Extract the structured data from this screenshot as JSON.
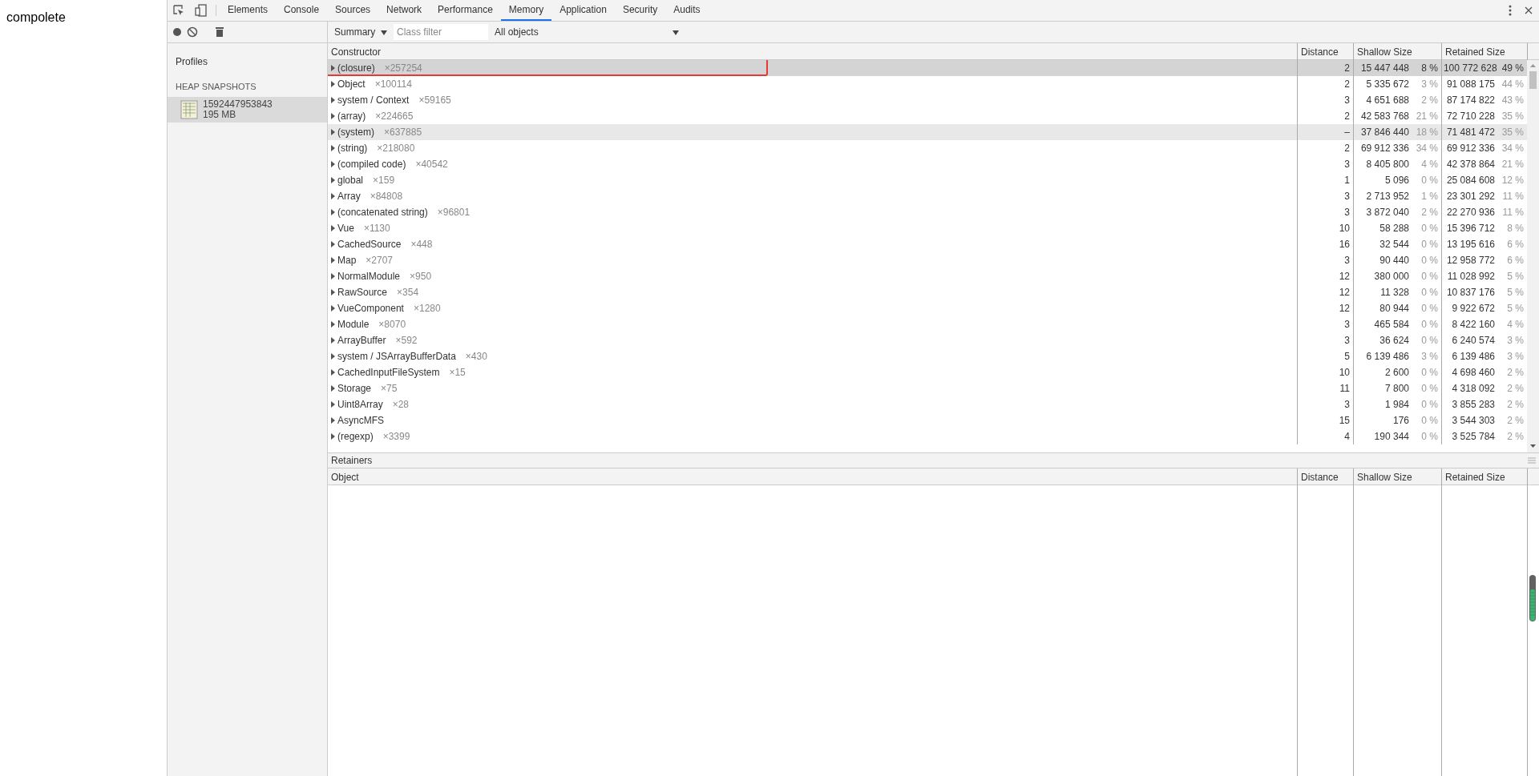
{
  "page_text": "compolete",
  "tabs": [
    {
      "label": "Elements",
      "selected": false
    },
    {
      "label": "Console",
      "selected": false
    },
    {
      "label": "Sources",
      "selected": false
    },
    {
      "label": "Network",
      "selected": false
    },
    {
      "label": "Performance",
      "selected": false
    },
    {
      "label": "Memory",
      "selected": true
    },
    {
      "label": "Application",
      "selected": false
    },
    {
      "label": "Security",
      "selected": false
    },
    {
      "label": "Audits",
      "selected": false
    }
  ],
  "toolbar": {
    "view": "Summary",
    "filter_placeholder": "Class filter",
    "scope": "All objects"
  },
  "sidebar": {
    "title": "Profiles",
    "section": "HEAP SNAPSHOTS",
    "items": [
      {
        "name": "1592447953843",
        "size": "195 MB",
        "selected": true
      }
    ]
  },
  "table": {
    "columns": [
      "Constructor",
      "Distance",
      "Shallow Size",
      "Retained Size"
    ],
    "rows": [
      {
        "name": "(closure)",
        "count": "×257254",
        "distance": "2",
        "shallow": "15 447 448",
        "shallow_pct": "8 %",
        "retained": "100 772 628",
        "retained_pct": "49 %",
        "selected": true,
        "hovered": false
      },
      {
        "name": "Object",
        "count": "×100114",
        "distance": "2",
        "shallow": "5 335 672",
        "shallow_pct": "3 %",
        "retained": "91 088 175",
        "retained_pct": "44 %",
        "selected": false,
        "hovered": false
      },
      {
        "name": "system / Context",
        "count": "×59165",
        "distance": "3",
        "shallow": "4 651 688",
        "shallow_pct": "2 %",
        "retained": "87 174 822",
        "retained_pct": "43 %",
        "selected": false,
        "hovered": false
      },
      {
        "name": "(array)",
        "count": "×224665",
        "distance": "2",
        "shallow": "42 583 768",
        "shallow_pct": "21 %",
        "retained": "72 710 228",
        "retained_pct": "35 %",
        "selected": false,
        "hovered": false
      },
      {
        "name": "(system)",
        "count": "×637885",
        "distance": "–",
        "shallow": "37 846 440",
        "shallow_pct": "18 %",
        "retained": "71 481 472",
        "retained_pct": "35 %",
        "selected": false,
        "hovered": true
      },
      {
        "name": "(string)",
        "count": "×218080",
        "distance": "2",
        "shallow": "69 912 336",
        "shallow_pct": "34 %",
        "retained": "69 912 336",
        "retained_pct": "34 %",
        "selected": false,
        "hovered": false
      },
      {
        "name": "(compiled code)",
        "count": "×40542",
        "distance": "3",
        "shallow": "8 405 800",
        "shallow_pct": "4 %",
        "retained": "42 378 864",
        "retained_pct": "21 %",
        "selected": false,
        "hovered": false
      },
      {
        "name": "global",
        "count": "×159",
        "distance": "1",
        "shallow": "5 096",
        "shallow_pct": "0 %",
        "retained": "25 084 608",
        "retained_pct": "12 %",
        "selected": false,
        "hovered": false
      },
      {
        "name": "Array",
        "count": "×84808",
        "distance": "3",
        "shallow": "2 713 952",
        "shallow_pct": "1 %",
        "retained": "23 301 292",
        "retained_pct": "11 %",
        "selected": false,
        "hovered": false
      },
      {
        "name": "(concatenated string)",
        "count": "×96801",
        "distance": "3",
        "shallow": "3 872 040",
        "shallow_pct": "2 %",
        "retained": "22 270 936",
        "retained_pct": "11 %",
        "selected": false,
        "hovered": false
      },
      {
        "name": "Vue",
        "count": "×1130",
        "distance": "10",
        "shallow": "58 288",
        "shallow_pct": "0 %",
        "retained": "15 396 712",
        "retained_pct": "8 %",
        "selected": false,
        "hovered": false
      },
      {
        "name": "CachedSource",
        "count": "×448",
        "distance": "16",
        "shallow": "32 544",
        "shallow_pct": "0 %",
        "retained": "13 195 616",
        "retained_pct": "6 %",
        "selected": false,
        "hovered": false
      },
      {
        "name": "Map",
        "count": "×2707",
        "distance": "3",
        "shallow": "90 440",
        "shallow_pct": "0 %",
        "retained": "12 958 772",
        "retained_pct": "6 %",
        "selected": false,
        "hovered": false
      },
      {
        "name": "NormalModule",
        "count": "×950",
        "distance": "12",
        "shallow": "380 000",
        "shallow_pct": "0 %",
        "retained": "11 028 992",
        "retained_pct": "5 %",
        "selected": false,
        "hovered": false
      },
      {
        "name": "RawSource",
        "count": "×354",
        "distance": "12",
        "shallow": "11 328",
        "shallow_pct": "0 %",
        "retained": "10 837 176",
        "retained_pct": "5 %",
        "selected": false,
        "hovered": false
      },
      {
        "name": "VueComponent",
        "count": "×1280",
        "distance": "12",
        "shallow": "80 944",
        "shallow_pct": "0 %",
        "retained": "9 922 672",
        "retained_pct": "5 %",
        "selected": false,
        "hovered": false
      },
      {
        "name": "Module",
        "count": "×8070",
        "distance": "3",
        "shallow": "465 584",
        "shallow_pct": "0 %",
        "retained": "8 422 160",
        "retained_pct": "4 %",
        "selected": false,
        "hovered": false
      },
      {
        "name": "ArrayBuffer",
        "count": "×592",
        "distance": "3",
        "shallow": "36 624",
        "shallow_pct": "0 %",
        "retained": "6 240 574",
        "retained_pct": "3 %",
        "selected": false,
        "hovered": false
      },
      {
        "name": "system / JSArrayBufferData",
        "count": "×430",
        "distance": "5",
        "shallow": "6 139 486",
        "shallow_pct": "3 %",
        "retained": "6 139 486",
        "retained_pct": "3 %",
        "selected": false,
        "hovered": false
      },
      {
        "name": "CachedInputFileSystem",
        "count": "×15",
        "distance": "10",
        "shallow": "2 600",
        "shallow_pct": "0 %",
        "retained": "4 698 460",
        "retained_pct": "2 %",
        "selected": false,
        "hovered": false
      },
      {
        "name": "Storage",
        "count": "×75",
        "distance": "11",
        "shallow": "7 800",
        "shallow_pct": "0 %",
        "retained": "4 318 092",
        "retained_pct": "2 %",
        "selected": false,
        "hovered": false
      },
      {
        "name": "Uint8Array",
        "count": "×28",
        "distance": "3",
        "shallow": "1 984",
        "shallow_pct": "0 %",
        "retained": "3 855 283",
        "retained_pct": "2 %",
        "selected": false,
        "hovered": false
      },
      {
        "name": "AsyncMFS",
        "distance": "15",
        "shallow": "176",
        "shallow_pct": "0 %",
        "retained": "3 544 303",
        "retained_pct": "2 %",
        "selected": false,
        "hovered": false
      },
      {
        "name": "(regexp)",
        "count": "×3399",
        "distance": "4",
        "shallow": "190 344",
        "shallow_pct": "0 %",
        "retained": "3 525 784",
        "retained_pct": "2 %",
        "selected": false,
        "hovered": false
      }
    ]
  },
  "retainers": {
    "title": "Retainers",
    "columns": [
      "Object",
      "Distance",
      "Shallow Size",
      "Retained Size"
    ]
  }
}
